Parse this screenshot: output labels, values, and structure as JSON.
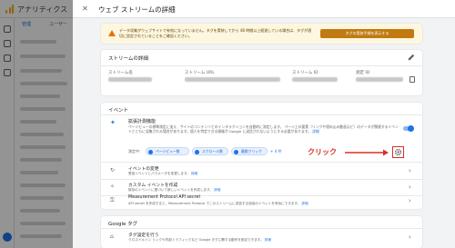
{
  "background_app": {
    "title": "アナリティクス",
    "tabs": [
      "管理",
      "ユーザー"
    ],
    "accent": "#1a73e8"
  },
  "panel": {
    "title": "ウェブ ストリームの詳細",
    "close_icon": "close-icon"
  },
  "warning": {
    "text": "データ収集がウェブサイトで有効になっていません。タグを実装してから 48 時間以上経過している場合は、タグが適切に設定されていることをご確認ください。",
    "button": "タグの実装手順を表示する",
    "color": "#e37400"
  },
  "stream_details": {
    "title": "ストリームの詳細",
    "labels": {
      "name": "ストリーム名",
      "url": "ストリーム URL",
      "id": "ストリーム ID",
      "measurement_id": "測定 ID"
    }
  },
  "events": {
    "title": "イベント",
    "enhanced": {
      "title": "拡張計測機能",
      "description": "ページビューの標準測定に加え、サイトのコンテンツとのインタラクションを自動的に測定します。",
      "description2": "ページ上の要素（リンクや埋め込み動画など）のデータが関連するイベントとともに収集される場合があります。個人を特定できる情報が Google に送信されないようにする必要があります。",
      "link": "詳細",
      "toggle_on": true,
      "measured_label": "測定中：",
      "chips": [
        "ページビュー数",
        "スクロール数",
        "離脱クリック"
      ],
      "more": "+ 4 件"
    },
    "annotation": "クリック",
    "rows": [
      {
        "title": "イベントの変更",
        "desc": "受信イベントとパラメータを変更します。",
        "link": "詳細"
      },
      {
        "title": "カスタム イベントを作成",
        "desc": "既存のイベントに基づいて新しいイベントを作成します。",
        "link": "詳細"
      },
      {
        "title": "Measurement Protocol API secret",
        "desc": "API secret を作成すると、Measurement Protocol でこのストリームに送信する追加のイベントを有効にできます。",
        "link": "詳細"
      }
    ]
  },
  "google_tag": {
    "title": "Google タグ",
    "row": {
      "title": "タグ設定を行う",
      "desc": "クロスドメイン リンクや内部トラフィックなど Google タグに関する動作を設定できます。",
      "link": "詳細"
    }
  }
}
